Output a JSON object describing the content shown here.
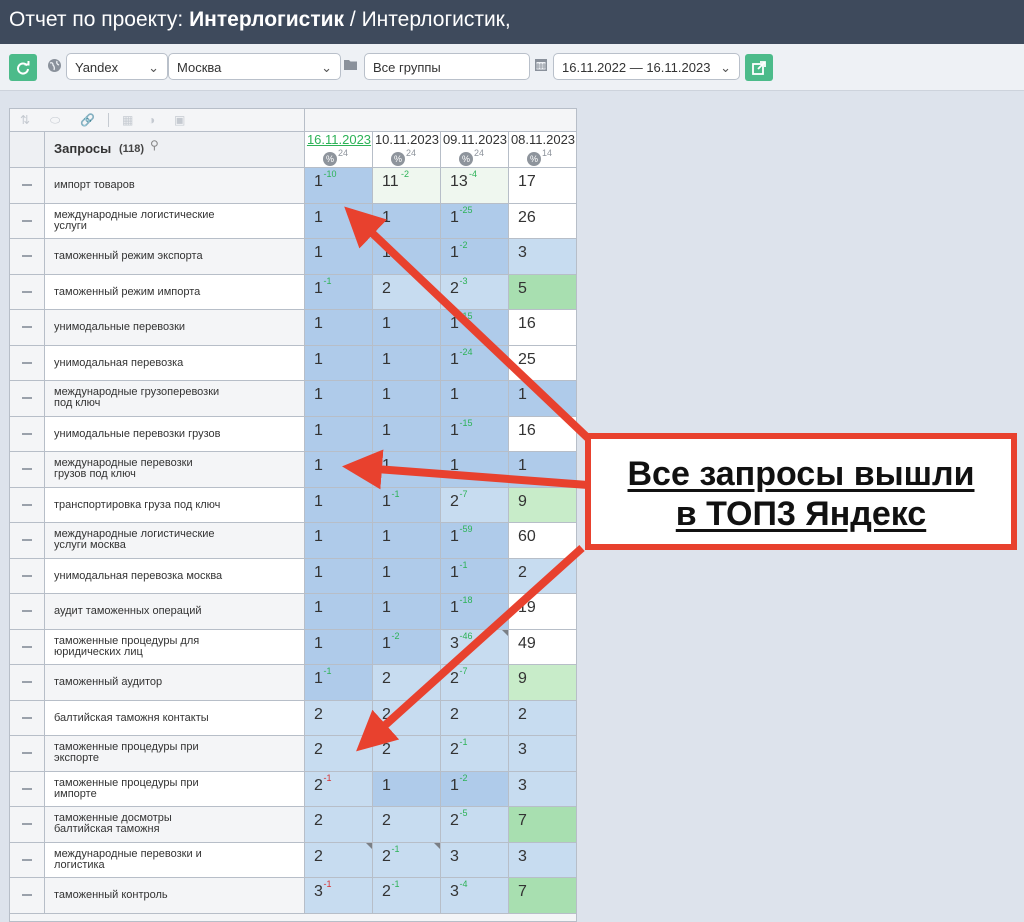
{
  "title": {
    "prefix": "Отчет по проекту: ",
    "project": "Интерлогистик",
    "suffix": " / Интерлогистик,"
  },
  "toolbar": {
    "engine": "Yandex",
    "region": "Москва",
    "group": "Все группы",
    "date_range": "16.11.2022 — 16.11.2023",
    "icons": [
      "refresh-icon",
      "globe-icon",
      "folder-icon",
      "calendar-icon",
      "export-icon"
    ]
  },
  "table": {
    "header": {
      "label": "Запросы",
      "count": "(118)"
    },
    "columns": [
      {
        "date": "16.11.2023",
        "num": "24",
        "active": true
      },
      {
        "date": "10.11.2023",
        "num": "24",
        "active": false
      },
      {
        "date": "09.11.2023",
        "num": "24",
        "active": false
      },
      {
        "date": "08.11.2023",
        "num": "14",
        "active": false
      }
    ],
    "rows": [
      {
        "kw": [
          "импорт товаров"
        ],
        "cells": [
          {
            "v": "1",
            "d": "-10",
            "dc": "gr",
            "bg": "#afcbea"
          },
          {
            "v": "11",
            "d": "-2",
            "dc": "gr",
            "bg": "#eff7ef"
          },
          {
            "v": "13",
            "d": "-4",
            "dc": "gr",
            "bg": "#eff7ef"
          },
          {
            "v": "17",
            "bg": "#ffffff"
          }
        ]
      },
      {
        "kw": [
          "международные логистические",
          "услуги"
        ],
        "cells": [
          {
            "v": "1",
            "bg": "#afcbea"
          },
          {
            "v": "1",
            "bg": "#afcbea"
          },
          {
            "v": "1",
            "d": "-25",
            "dc": "gr",
            "bg": "#afcbea"
          },
          {
            "v": "26",
            "bg": "#ffffff"
          }
        ]
      },
      {
        "kw": [
          "таможенный режим экспорта"
        ],
        "cells": [
          {
            "v": "1",
            "bg": "#afcbea"
          },
          {
            "v": "1",
            "bg": "#afcbea"
          },
          {
            "v": "1",
            "d": "-2",
            "dc": "gr",
            "bg": "#afcbea"
          },
          {
            "v": "3",
            "bg": "#c7dcf0"
          }
        ]
      },
      {
        "kw": [
          "таможенный режим импорта"
        ],
        "cells": [
          {
            "v": "1",
            "d": "-1",
            "dc": "gr",
            "bg": "#afcbea"
          },
          {
            "v": "2",
            "bg": "#c7dcf0"
          },
          {
            "v": "2",
            "d": "-3",
            "dc": "gr",
            "bg": "#c7dcf0"
          },
          {
            "v": "5",
            "bg": "#a8dfb0"
          }
        ]
      },
      {
        "kw": [
          "унимодальные перевозки"
        ],
        "cells": [
          {
            "v": "1",
            "bg": "#afcbea"
          },
          {
            "v": "1",
            "bg": "#afcbea"
          },
          {
            "v": "1",
            "d": "-15",
            "dc": "gr",
            "bg": "#afcbea"
          },
          {
            "v": "16",
            "bg": "#ffffff"
          }
        ]
      },
      {
        "kw": [
          "унимодальная перевозка"
        ],
        "cells": [
          {
            "v": "1",
            "bg": "#afcbea"
          },
          {
            "v": "1",
            "bg": "#afcbea"
          },
          {
            "v": "1",
            "d": "-24",
            "dc": "gr",
            "bg": "#afcbea"
          },
          {
            "v": "25",
            "bg": "#ffffff"
          }
        ]
      },
      {
        "kw": [
          "международные грузоперевозки",
          "под ключ"
        ],
        "cells": [
          {
            "v": "1",
            "bg": "#afcbea"
          },
          {
            "v": "1",
            "bg": "#afcbea"
          },
          {
            "v": "1",
            "bg": "#afcbea"
          },
          {
            "v": "1",
            "bg": "#afcbea"
          }
        ]
      },
      {
        "kw": [
          "унимодальные перевозки грузов"
        ],
        "cells": [
          {
            "v": "1",
            "bg": "#afcbea"
          },
          {
            "v": "1",
            "bg": "#afcbea"
          },
          {
            "v": "1",
            "d": "-15",
            "dc": "gr",
            "bg": "#afcbea"
          },
          {
            "v": "16",
            "bg": "#ffffff"
          }
        ]
      },
      {
        "kw": [
          "международные перевозки",
          "грузов под ключ"
        ],
        "cells": [
          {
            "v": "1",
            "bg": "#afcbea"
          },
          {
            "v": "1",
            "bg": "#afcbea"
          },
          {
            "v": "1",
            "bg": "#afcbea"
          },
          {
            "v": "1",
            "bg": "#afcbea"
          }
        ]
      },
      {
        "kw": [
          "транспортировка груза под ключ"
        ],
        "cells": [
          {
            "v": "1",
            "bg": "#afcbea"
          },
          {
            "v": "1",
            "d": "-1",
            "dc": "gr",
            "bg": "#afcbea"
          },
          {
            "v": "2",
            "d": "-7",
            "dc": "gr",
            "bg": "#c7dcf0"
          },
          {
            "v": "9",
            "bg": "#c8ecc9"
          }
        ]
      },
      {
        "kw": [
          "международные логистические",
          "услуги москва"
        ],
        "cells": [
          {
            "v": "1",
            "bg": "#afcbea"
          },
          {
            "v": "1",
            "bg": "#afcbea"
          },
          {
            "v": "1",
            "d": "-59",
            "dc": "gr",
            "bg": "#afcbea"
          },
          {
            "v": "60",
            "bg": "#ffffff"
          }
        ]
      },
      {
        "kw": [
          "унимодальная перевозка москва"
        ],
        "cells": [
          {
            "v": "1",
            "bg": "#afcbea"
          },
          {
            "v": "1",
            "bg": "#afcbea"
          },
          {
            "v": "1",
            "d": "-1",
            "dc": "gr",
            "bg": "#afcbea"
          },
          {
            "v": "2",
            "bg": "#c7dcf0"
          }
        ]
      },
      {
        "kw": [
          "аудит таможенных операций"
        ],
        "cells": [
          {
            "v": "1",
            "bg": "#afcbea"
          },
          {
            "v": "1",
            "bg": "#afcbea"
          },
          {
            "v": "1",
            "d": "-18",
            "dc": "gr",
            "bg": "#afcbea"
          },
          {
            "v": "19",
            "bg": "#ffffff"
          }
        ]
      },
      {
        "kw": [
          "таможенные процедуры для",
          "юридических лиц"
        ],
        "cells": [
          {
            "v": "1",
            "bg": "#afcbea"
          },
          {
            "v": "1",
            "d": "-2",
            "dc": "gr",
            "bg": "#afcbea"
          },
          {
            "v": "3",
            "d": "-46",
            "dc": "gr",
            "bg": "#c7dcf0",
            "tri": true
          },
          {
            "v": "49",
            "bg": "#ffffff"
          }
        ]
      },
      {
        "kw": [
          "таможенный аудитор"
        ],
        "cells": [
          {
            "v": "1",
            "d": "-1",
            "dc": "gr",
            "bg": "#afcbea"
          },
          {
            "v": "2",
            "bg": "#c7dcf0"
          },
          {
            "v": "2",
            "d": "-7",
            "dc": "gr",
            "bg": "#c7dcf0"
          },
          {
            "v": "9",
            "bg": "#c8ecc9"
          }
        ]
      },
      {
        "kw": [
          "балтийская таможня контакты"
        ],
        "cells": [
          {
            "v": "2",
            "bg": "#c7dcf0"
          },
          {
            "v": "2",
            "bg": "#c7dcf0"
          },
          {
            "v": "2",
            "bg": "#c7dcf0"
          },
          {
            "v": "2",
            "bg": "#c7dcf0"
          }
        ]
      },
      {
        "kw": [
          "таможенные процедуры при",
          "экспорте"
        ],
        "cells": [
          {
            "v": "2",
            "bg": "#c7dcf0"
          },
          {
            "v": "2",
            "bg": "#c7dcf0"
          },
          {
            "v": "2",
            "d": "-1",
            "dc": "gr",
            "bg": "#c7dcf0"
          },
          {
            "v": "3",
            "bg": "#c7dcf0"
          }
        ]
      },
      {
        "kw": [
          "таможенные процедуры при",
          "импорте"
        ],
        "cells": [
          {
            "v": "2",
            "d": "-1",
            "dc": "rd",
            "bg": "#c7dcf0"
          },
          {
            "v": "1",
            "bg": "#afcbea"
          },
          {
            "v": "1",
            "d": "-2",
            "dc": "gr",
            "bg": "#afcbea"
          },
          {
            "v": "3",
            "bg": "#c7dcf0"
          }
        ]
      },
      {
        "kw": [
          "таможенные досмотры",
          "балтийская таможня"
        ],
        "cells": [
          {
            "v": "2",
            "bg": "#c7dcf0"
          },
          {
            "v": "2",
            "bg": "#c7dcf0"
          },
          {
            "v": "2",
            "d": "-5",
            "dc": "gr",
            "bg": "#c7dcf0"
          },
          {
            "v": "7",
            "bg": "#a8dfb0"
          }
        ]
      },
      {
        "kw": [
          "международные перевозки и",
          "логистика"
        ],
        "cells": [
          {
            "v": "2",
            "bg": "#c7dcf0",
            "tri": true
          },
          {
            "v": "2",
            "d": "-1",
            "dc": "gr",
            "bg": "#c7dcf0",
            "tri": true
          },
          {
            "v": "3",
            "bg": "#c7dcf0"
          },
          {
            "v": "3",
            "bg": "#c7dcf0"
          }
        ]
      },
      {
        "kw": [
          "таможенный контроль"
        ],
        "cells": [
          {
            "v": "3",
            "d": "-1",
            "dc": "rd",
            "bg": "#c7dcf0"
          },
          {
            "v": "2",
            "d": "-1",
            "dc": "gr",
            "bg": "#c7dcf0"
          },
          {
            "v": "3",
            "d": "-4",
            "dc": "gr",
            "bg": "#c7dcf0"
          },
          {
            "v": "7",
            "bg": "#a8dfb0"
          }
        ]
      }
    ]
  },
  "callout": {
    "line1": "Все запросы вышли",
    "line2": "в ТОП3 Яндекс"
  },
  "colors": {
    "header_bg": "#3e4a5c",
    "accent_green": "#4cbb8a",
    "arrow_red": "#e8412e"
  }
}
